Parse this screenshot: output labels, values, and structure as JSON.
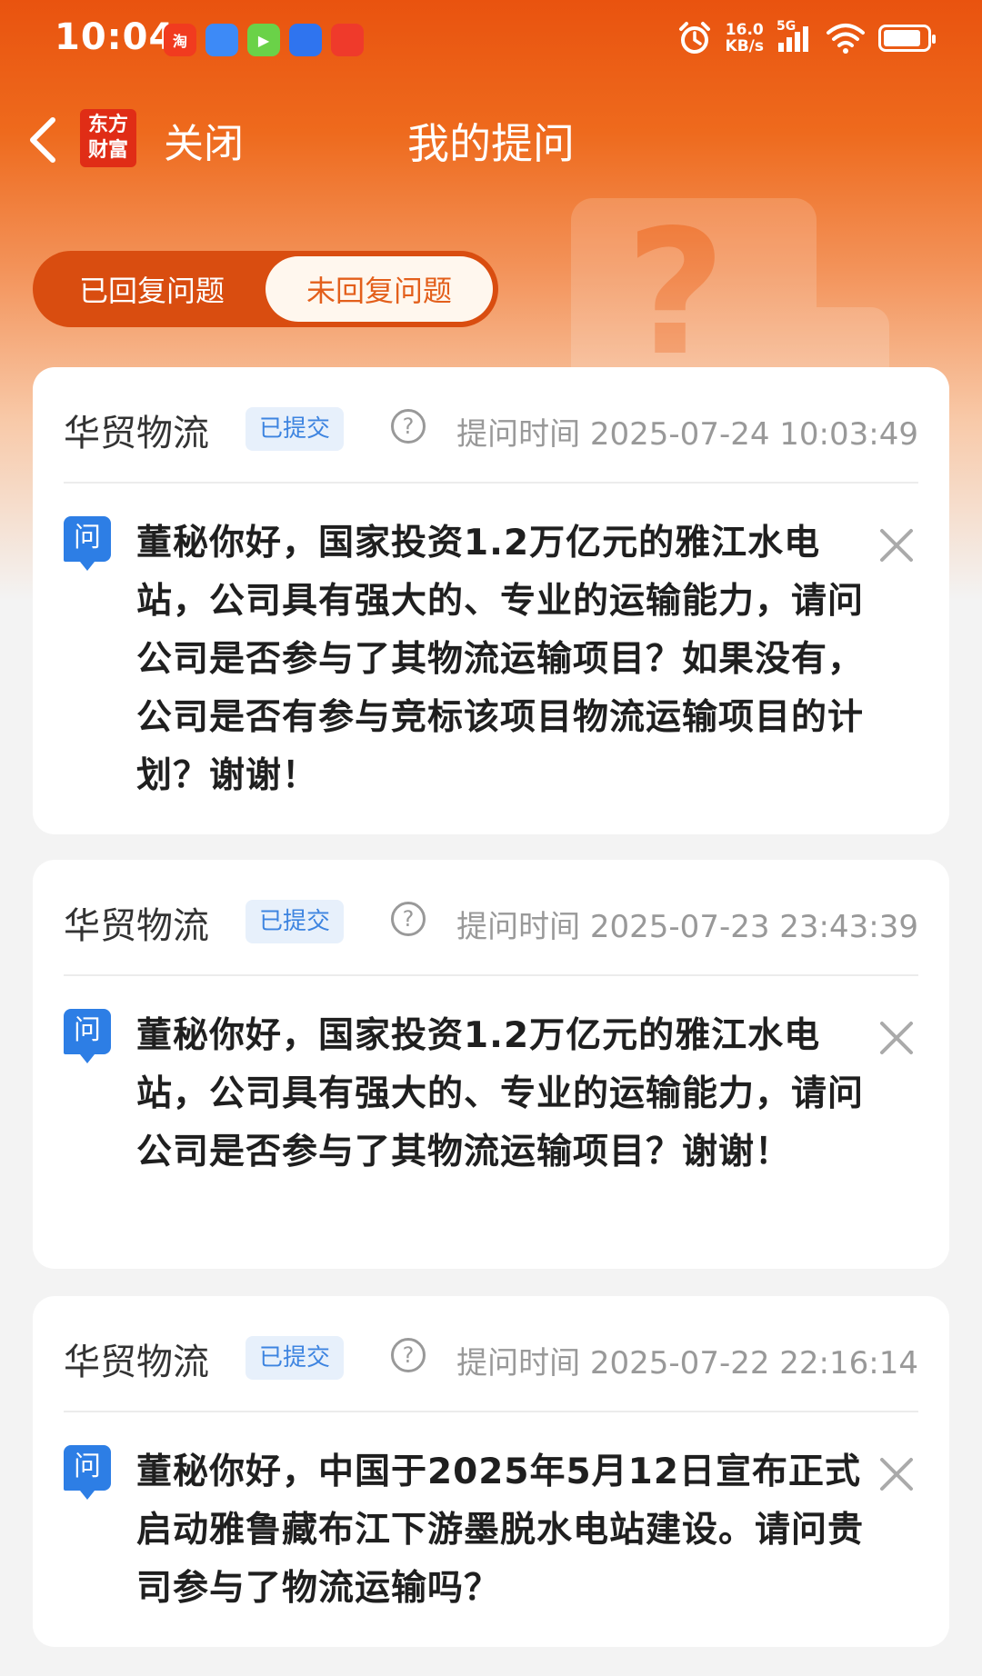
{
  "status_bar": {
    "time": "10:04",
    "net_speed_value": "16.0",
    "net_speed_unit": "KB/s",
    "network": "5G",
    "app_icons": [
      {
        "name": "taobao-icon",
        "label": "淘",
        "color": "#f13b1f"
      },
      {
        "name": "app-blue-icon",
        "label": "",
        "color": "#3d8af7"
      },
      {
        "name": "video-icon",
        "label": "▶",
        "color": "#6ad248"
      },
      {
        "name": "browser-icon",
        "label": "",
        "color": "#2f74ef"
      },
      {
        "name": "app-red-icon",
        "label": "",
        "color": "#ef3a2b"
      }
    ]
  },
  "nav": {
    "brand_line1": "东方",
    "brand_line2": "财富",
    "close_label": "关闭",
    "title": "我的提问"
  },
  "tabs": [
    {
      "label": "已回复问题",
      "active": false
    },
    {
      "label": "未回复问题",
      "active": true
    }
  ],
  "questions": [
    {
      "company": "华贸物流",
      "status": "已提交",
      "time": "提问时间 2025-07-24 10:03:49",
      "icon_label": "问",
      "text": "董秘你好，国家投资1.2万亿元的雅江水电站，公司具有强大的、专业的运输能力，请问公司是否参与了其物流运输项目？如果没有，公司是否有参与竞标该项目物流运输项目的计划？谢谢！"
    },
    {
      "company": "华贸物流",
      "status": "已提交",
      "time": "提问时间 2025-07-23 23:43:39",
      "icon_label": "问",
      "text": "董秘你好，国家投资1.2万亿元的雅江水电站，公司具有强大的、专业的运输能力，请问公司是否参与了其物流运输项目？谢谢！"
    },
    {
      "company": "华贸物流",
      "status": "已提交",
      "time": "提问时间 2025-07-22 22:16:14",
      "icon_label": "问",
      "text": "董秘你好，中国于2025年5月12日宣布正式启动雅鲁藏布江下游墨脱水电站建设。请问贵司参与了物流运输吗？"
    }
  ],
  "help_symbol": "?",
  "colors": {
    "header_orange": "#e9530f",
    "badge_blue": "#3d84e0",
    "question_icon_blue": "#2d7ee5",
    "active_tab_text": "#e35f1b"
  }
}
